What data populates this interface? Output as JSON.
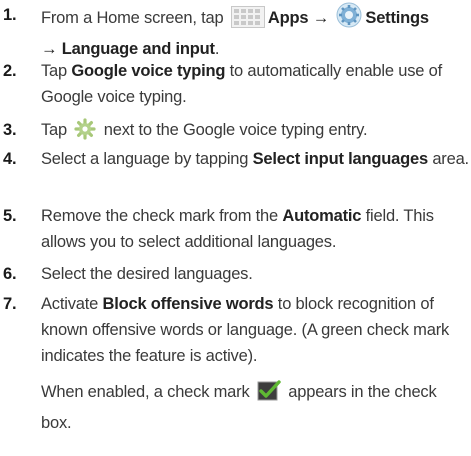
{
  "steps": [
    {
      "num": "1.",
      "t1": "From a Home screen, tap ",
      "apps": "Apps",
      "arrow1": " → ",
      "settings": "Settings",
      "arrow2": "→ ",
      "lang_input": "Language and input",
      "end": "."
    },
    {
      "num": "2.",
      "t1": "Tap ",
      "gvt": "Google voice typing",
      "t2": " to automatically enable use of Google voice typing."
    },
    {
      "num": "3.",
      "t1": "Tap ",
      "t2": " next to the Google voice typing entry."
    },
    {
      "num": "4.",
      "t1": "Select a language by tapping ",
      "sel": "Select input languages",
      "t2": " area."
    },
    {
      "num": "5.",
      "t1": "Remove the check mark from the ",
      "auto": "Automatic",
      "t2": " field. This allows you to select additional languages."
    },
    {
      "num": "6.",
      "t1": "Select the desired languages."
    },
    {
      "num": "7.",
      "t1": "Activate ",
      "block": "Block offensive words",
      "t2": " to block recognition of known offensive words or language. (A green check mark indicates the feature is active).",
      "t3": "When enabled, a check mark ",
      "t4": " appears in the check box."
    }
  ],
  "icons": {
    "apps": "apps-grid-icon",
    "settings": "settings-gear-icon",
    "gear": "gear-icon",
    "check": "green-checkbox-icon"
  },
  "colors": {
    "check_green": "#5fb833",
    "text": "#333333"
  }
}
